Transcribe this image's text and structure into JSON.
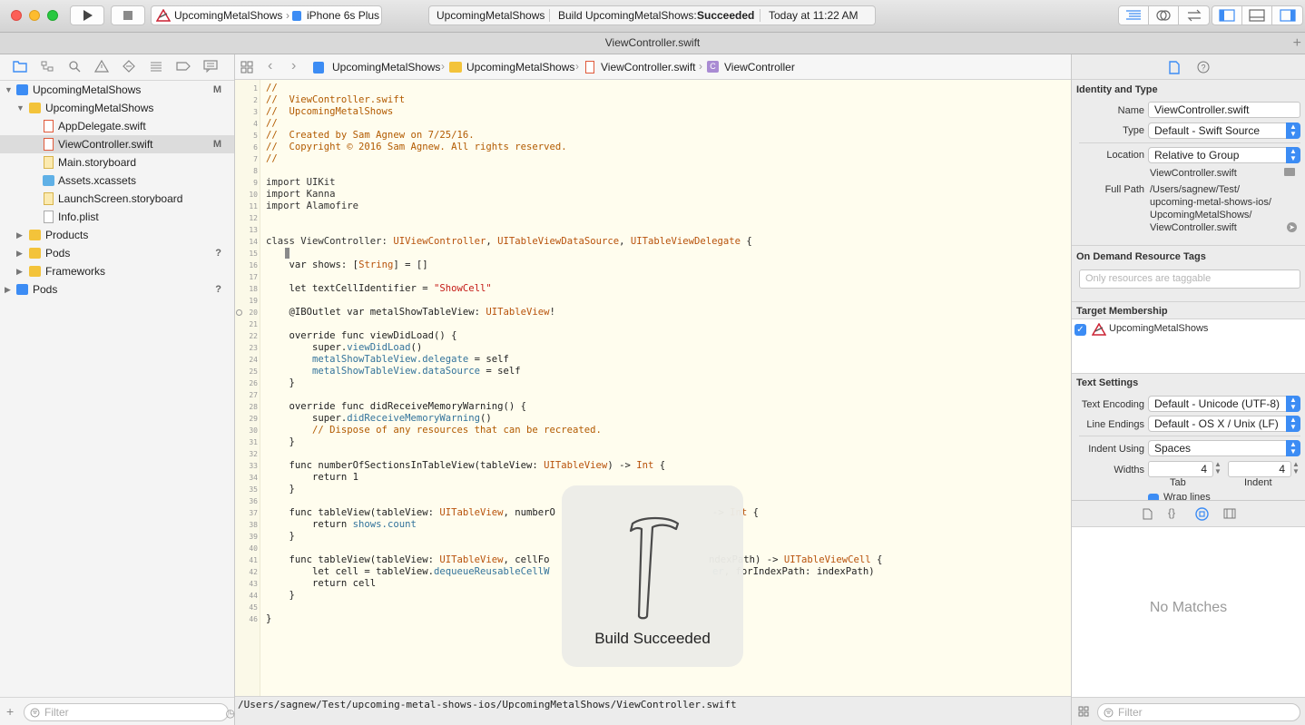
{
  "toolbar": {
    "scheme_project": "UpcomingMetalShows",
    "scheme_device": "iPhone 6s Plus",
    "activity_project": "UpcomingMetalShows",
    "activity_status_prefix": "Build UpcomingMetalShows:",
    "activity_status": "Succeeded",
    "activity_time": "Today at 11:22 AM"
  },
  "tab_title": "ViewController.swift",
  "navigator": {
    "items": [
      {
        "label": "UpcomingMetalShows",
        "marker": "M"
      },
      {
        "label": "UpcomingMetalShows",
        "marker": ""
      },
      {
        "label": "AppDelegate.swift",
        "marker": ""
      },
      {
        "label": "ViewController.swift",
        "marker": "M"
      },
      {
        "label": "Main.storyboard",
        "marker": ""
      },
      {
        "label": "Assets.xcassets",
        "marker": ""
      },
      {
        "label": "LaunchScreen.storyboard",
        "marker": ""
      },
      {
        "label": "Info.plist",
        "marker": ""
      },
      {
        "label": "Products",
        "marker": ""
      },
      {
        "label": "Pods",
        "marker": "?"
      },
      {
        "label": "Frameworks",
        "marker": ""
      },
      {
        "label": "Pods",
        "marker": "?"
      }
    ],
    "filter_placeholder": "Filter"
  },
  "jumpbar": {
    "crumbs": [
      "UpcomingMetalShows",
      "UpcomingMetalShows",
      "ViewController.swift",
      "ViewController"
    ]
  },
  "code": {
    "line_numbers": [
      "1",
      "2",
      "3",
      "4",
      "5",
      "6",
      "7",
      "8",
      "9",
      "10",
      "11",
      "12",
      "13",
      "14",
      "15",
      "16",
      "17",
      "18",
      "19",
      "20",
      "21",
      "22",
      "23",
      "24",
      "25",
      "26",
      "27",
      "28",
      "29",
      "30",
      "31",
      "32",
      "33",
      "34",
      "35",
      "36",
      "37",
      "38",
      "39",
      "40",
      "41",
      "42",
      "43",
      "44",
      "45",
      "46"
    ],
    "l1": "//",
    "l2": "//  ViewController.swift",
    "l3": "//  UpcomingMetalShows",
    "l4": "//",
    "l5": "//  Created by Sam Agnew on 7/25/16.",
    "l6": "//  Copyright © 2016 Sam Agnew. All rights reserved.",
    "l7": "//",
    "l9": "import UIKit",
    "l10": "import Kanna",
    "l11": "import Alamofire",
    "l14a": "class ViewController: ",
    "l14b": "UIViewController",
    "l14c": ", ",
    "l14d": "UITableViewDataSource",
    "l14e": ", ",
    "l14f": "UITableViewDelegate",
    "l14g": " {",
    "l16a": "    var shows: [",
    "l16b": "String",
    "l16c": "] = []",
    "l18a": "    let textCellIdentifier = ",
    "l18b": "\"ShowCell\"",
    "l20a": "    @IBOutlet var metalShowTableView: ",
    "l20b": "UITableView",
    "l20c": "!",
    "l22": "    override func viewDidLoad() {",
    "l23a": "        super.",
    "l23b": "viewDidLoad",
    "l23c": "()",
    "l24a": "        metalShowTableView",
    "l24b": ".delegate",
    "l24c": " = self",
    "l25a": "        metalShowTableView",
    "l25b": ".dataSource",
    "l25c": " = self",
    "l26": "    }",
    "l28": "    override func didReceiveMemoryWarning() {",
    "l29a": "        super.",
    "l29b": "didReceiveMemoryWarning",
    "l29c": "()",
    "l30": "        // Dispose of any resources that can be recreated.",
    "l31": "    }",
    "l33a": "    func numberOfSectionsInTableView(tableView: ",
    "l33b": "UITableView",
    "l33c": ") -> ",
    "l33d": "Int",
    "l33e": " {",
    "l34": "        return 1",
    "l35": "    }",
    "l37a": "    func tableView(tableView: ",
    "l37b": "UITableView",
    "l37c": ", numberO",
    "l37d": "-> ",
    "l37e": "Int",
    "l37f": " {",
    "l38a": "        return ",
    "l38b": "shows.count",
    "l39": "    }",
    "l41a": "    func tableView(tableView: ",
    "l41b": "UITableView",
    "l41c": ", cellFo",
    "l41d": "ndexPath) -> ",
    "l41e": "UITableViewCell",
    "l41f": " {",
    "l42a": "        let cell = tableView.",
    "l42b": "dequeueReusableCellW",
    "l42c": "er",
    "l42d": ", forIndexPath: indexPath)",
    "l43": "        return cell",
    "l44": "    }",
    "l46": "}"
  },
  "status_path": "/Users/sagnew/Test/upcoming-metal-shows-ios/UpcomingMetalShows/ViewController.swift",
  "hud": {
    "label": "Build Succeeded"
  },
  "inspector": {
    "identity_title": "Identity and Type",
    "name_label": "Name",
    "name_value": "ViewController.swift",
    "type_label": "Type",
    "type_value": "Default - Swift Source",
    "location_label": "Location",
    "location_value": "Relative to Group",
    "location_file": "ViewController.swift",
    "fullpath_label": "Full Path",
    "fullpath_lines": [
      "/Users/sagnew/Test/",
      "upcoming-metal-shows-ios/",
      "UpcomingMetalShows/",
      "ViewController.swift"
    ],
    "odr_title": "On Demand Resource Tags",
    "odr_placeholder": "Only resources are taggable",
    "target_title": "Target Membership",
    "target_name": "UpcomingMetalShows",
    "text_settings_title": "Text Settings",
    "encoding_label": "Text Encoding",
    "encoding_value": "Default - Unicode (UTF-8)",
    "line_endings_label": "Line Endings",
    "line_endings_value": "Default - OS X / Unix (LF)",
    "indent_label": "Indent Using",
    "indent_value": "Spaces",
    "widths_label": "Widths",
    "tab_value": "4",
    "indent_width_value": "4",
    "tab_caption": "Tab",
    "indent_caption": "Indent",
    "wrap_label": "Wrap lines",
    "library_empty": "No Matches",
    "filter_placeholder": "Filter"
  },
  "colors": {
    "accent": "#3c8cf4",
    "editor_bg": "#fffdee",
    "comment": "#b25a00",
    "string": "#c41a16",
    "type": "#b8520b",
    "method": "#33739b"
  }
}
